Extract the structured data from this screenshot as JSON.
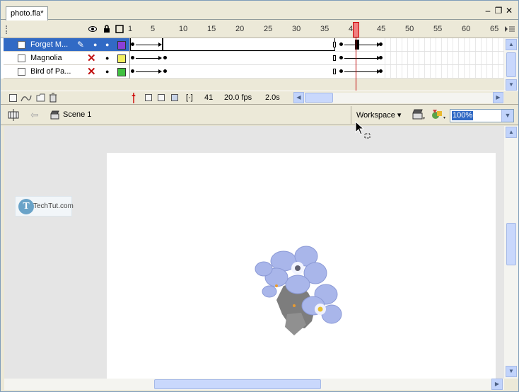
{
  "document": {
    "tab_label": "photo.fla*",
    "window_buttons": {
      "minimize": "–",
      "restore": "❐",
      "close": "✕"
    }
  },
  "timeline": {
    "ruler_ticks": [
      "1",
      "5",
      "10",
      "15",
      "20",
      "25",
      "30",
      "35",
      "40",
      "45",
      "50",
      "55",
      "60",
      "65"
    ],
    "current_frame_marker": "40",
    "layers": [
      {
        "name": "Forget M...",
        "selected": true,
        "hidden": false,
        "color": "#8b3fd8"
      },
      {
        "name": "Magnolia",
        "selected": false,
        "hidden": true,
        "color": "#f4f060"
      },
      {
        "name": "Bird of Pa...",
        "selected": false,
        "hidden": true,
        "color": "#40c040"
      }
    ],
    "status": {
      "current_frame": "41",
      "frame_rate": "20.0 fps",
      "elapsed_time": "2.0s"
    }
  },
  "editbar": {
    "scene_label": "Scene 1",
    "workspace_label": "Workspace ▾",
    "zoom_value": "100%"
  },
  "stage": {
    "logo_letter": "T",
    "logo_text": "TechTut.com",
    "colors": {
      "pasteboard": "#e5e5e5",
      "stage": "#ffffff",
      "selection": "#316ac5",
      "playhead": "#c00000"
    }
  }
}
